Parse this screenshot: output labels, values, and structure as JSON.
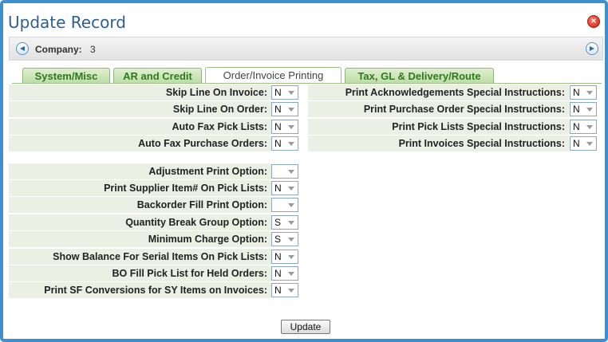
{
  "dialog": {
    "title": "Update Record",
    "close_glyph": "×"
  },
  "company": {
    "label": "Company:",
    "value": "3"
  },
  "tabs": [
    {
      "label": "System/Misc",
      "active": false
    },
    {
      "label": "AR and Credit",
      "active": false
    },
    {
      "label": "Order/Invoice Printing",
      "active": true
    },
    {
      "label": "Tax, GL & Delivery/Route",
      "active": false
    }
  ],
  "left_fields_top": [
    {
      "label": "Skip Line On Invoice:",
      "value": "N"
    },
    {
      "label": "Skip Line On Order:",
      "value": "N"
    },
    {
      "label": "Auto Fax Pick Lists:",
      "value": "N"
    },
    {
      "label": "Auto Fax Purchase Orders:",
      "value": "N"
    }
  ],
  "right_fields": [
    {
      "label": "Print Acknowledgements Special Instructions:",
      "value": "N"
    },
    {
      "label": "Print Purchase Order Special Instructions:",
      "value": "N"
    },
    {
      "label": "Print Pick Lists Special Instructions:",
      "value": "N"
    },
    {
      "label": "Print Invoices Special Instructions:",
      "value": "N"
    }
  ],
  "left_fields_bottom": [
    {
      "label": "Adjustment Print Option:",
      "value": ""
    },
    {
      "label": "Print Supplier Item# On Pick Lists:",
      "value": "N"
    },
    {
      "label": "Backorder Fill Print Option:",
      "value": ""
    },
    {
      "label": "Quantity Break Group Option:",
      "value": "S"
    },
    {
      "label": "Minimum Charge Option:",
      "value": "S"
    },
    {
      "label": "Show Balance For Serial Items On Pick Lists:",
      "value": "N"
    },
    {
      "label": "BO Fill Pick List for Held Orders:",
      "value": "N"
    },
    {
      "label": "Print SF Conversions for SY Items on Invoices:",
      "value": "N"
    }
  ],
  "buttons": {
    "update_label": "Update"
  },
  "icons": {
    "close": "close-icon",
    "prev": "arrow-left-icon",
    "next": "arrow-right-icon",
    "dropdown": "chevron-down-icon"
  },
  "colors": {
    "frame": "#3d8fd0",
    "title": "#2d5f91",
    "tab_text": "#2e7a1f",
    "row_bg": "#ecefe4"
  }
}
